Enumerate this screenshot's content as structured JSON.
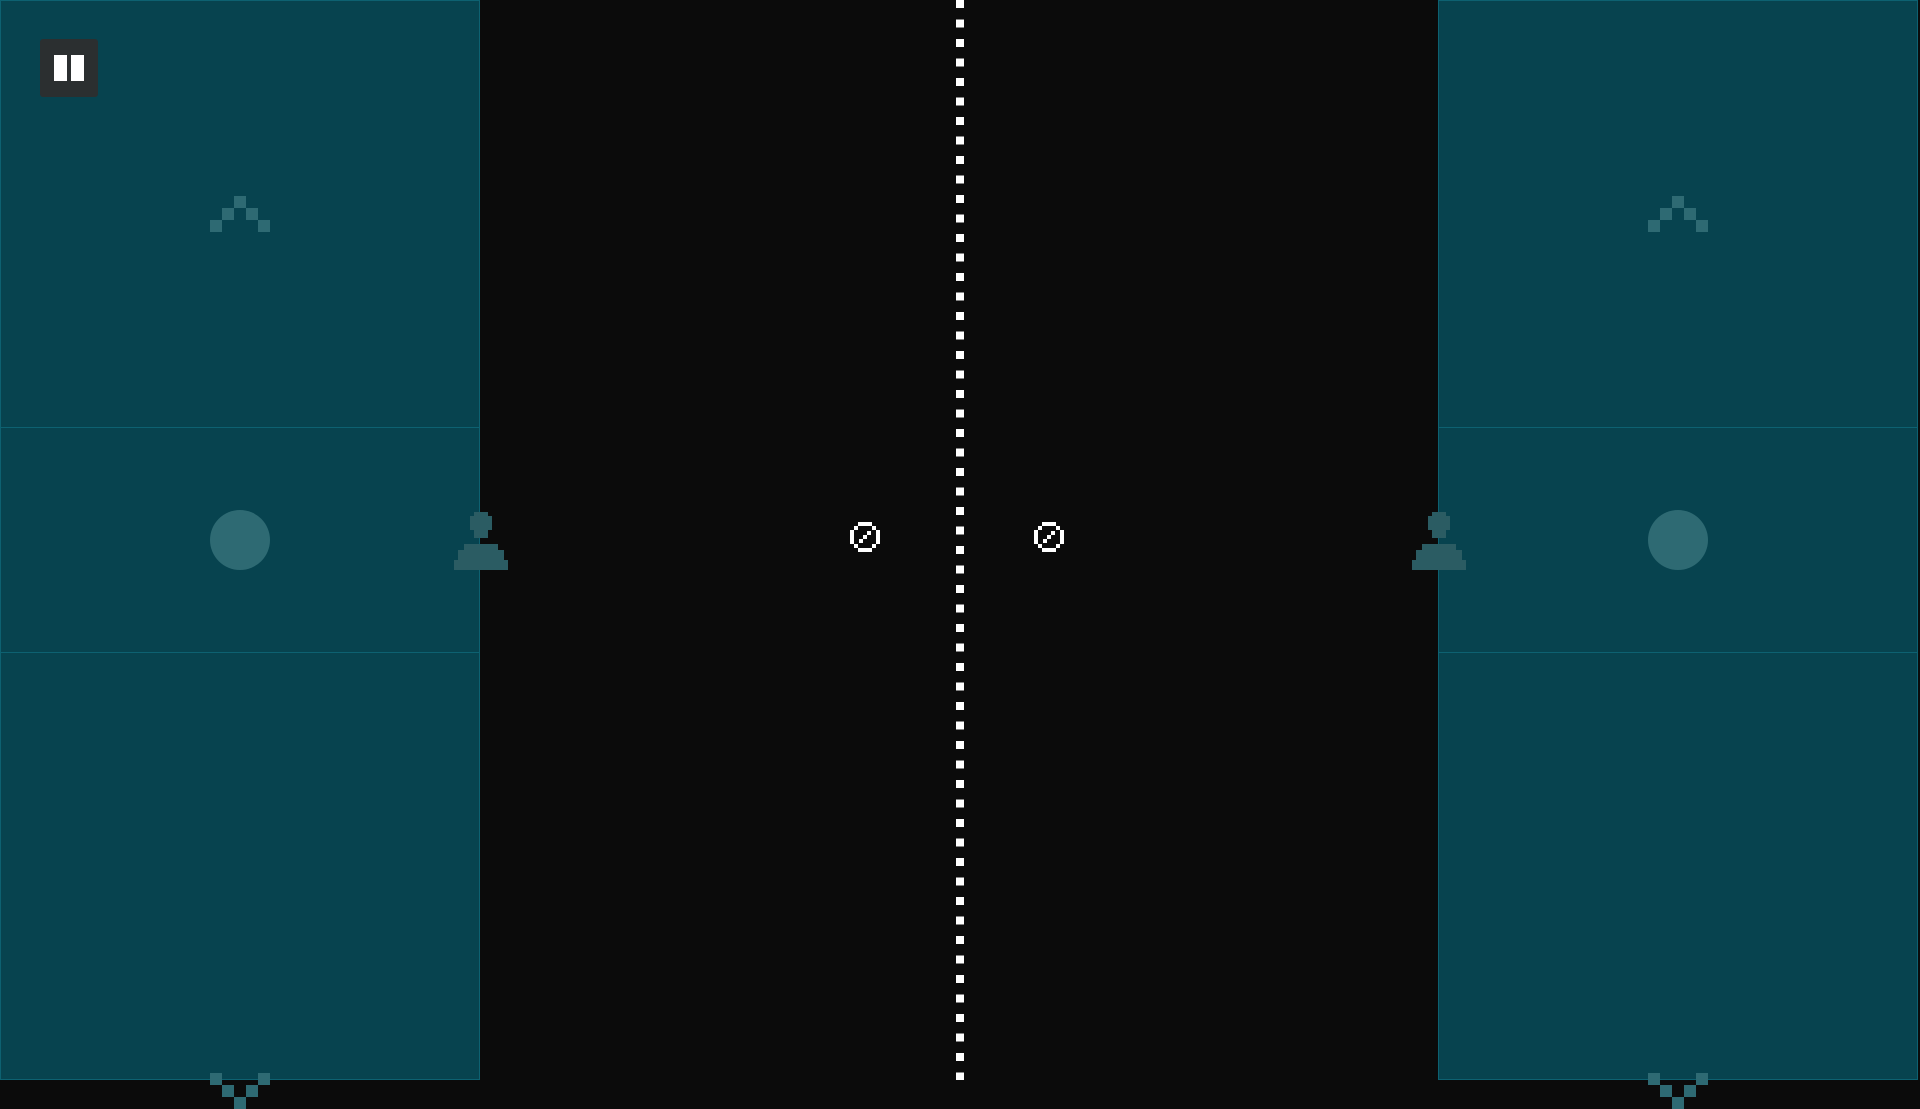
{
  "game": {
    "net_style": "dotted",
    "colors": {
      "court": "#0b0b0b",
      "control_panel": "#07434f",
      "panel_border": "#0d6171",
      "ghost_icon": "#2e6a73",
      "net": "#ffffff",
      "ball": "#ffffff",
      "player": "#2b5c63"
    }
  },
  "controls": {
    "pause_icon": "pause-icon",
    "left": {
      "up_icon": "chevron-up-icon",
      "action_icon": "circle-button-icon",
      "down_icon": "chevron-down-icon"
    },
    "right": {
      "up_icon": "chevron-up-icon",
      "action_icon": "circle-button-icon",
      "down_icon": "chevron-down-icon"
    }
  },
  "field": {
    "player_icon": "person-icon",
    "ball_icon": "ball-icon"
  }
}
